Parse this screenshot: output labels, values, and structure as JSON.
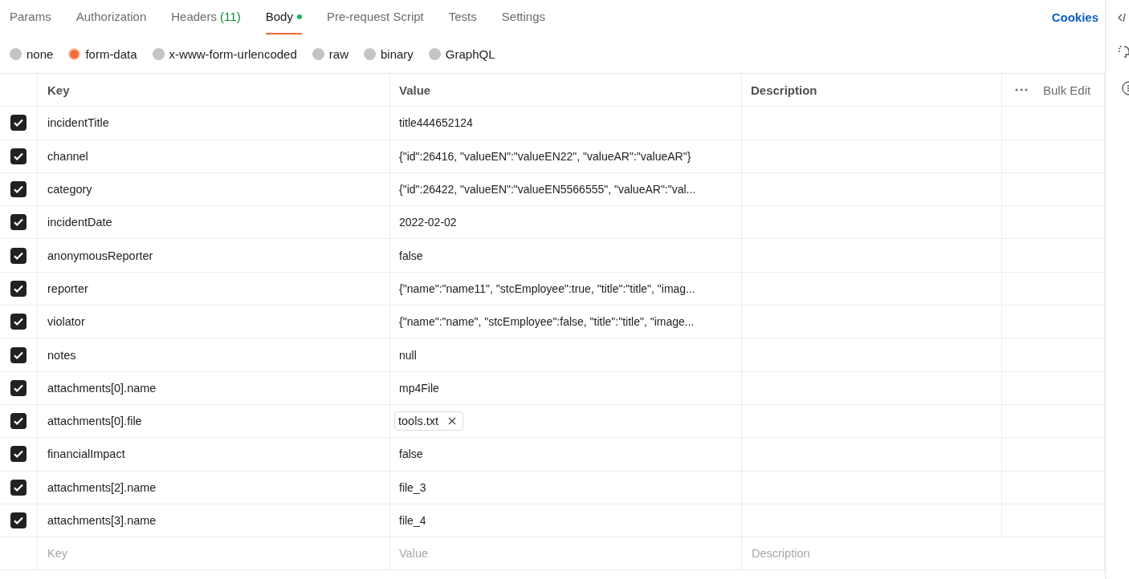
{
  "tabs": [
    {
      "label": "Params",
      "selected": false
    },
    {
      "label": "Authorization",
      "selected": false
    },
    {
      "label": "Headers",
      "count": "(11)",
      "selected": false
    },
    {
      "label": "Body",
      "dot": true,
      "selected": true
    },
    {
      "label": "Pre-request Script",
      "selected": false
    },
    {
      "label": "Tests",
      "selected": false
    },
    {
      "label": "Settings",
      "selected": false
    }
  ],
  "cookies_link": "Cookies",
  "body_types": [
    {
      "label": "none",
      "selected": false
    },
    {
      "label": "form-data",
      "selected": true
    },
    {
      "label": "x-www-form-urlencoded",
      "selected": false
    },
    {
      "label": "raw",
      "selected": false
    },
    {
      "label": "binary",
      "selected": false
    },
    {
      "label": "GraphQL",
      "selected": false
    }
  ],
  "table": {
    "columns": [
      "Key",
      "Value",
      "Description"
    ],
    "bulk_edit": "Bulk Edit",
    "rows": [
      {
        "checked": true,
        "key": "incidentTitle",
        "kind": "text",
        "value": "title444652124"
      },
      {
        "checked": true,
        "key": "channel",
        "kind": "text",
        "value": "{\"id\":26416, \"valueEN\":\"valueEN22\", \"valueAR\":\"valueAR\"}"
      },
      {
        "checked": true,
        "key": "category",
        "kind": "text",
        "value": "{\"id\":26422, \"valueEN\":\"valueEN5566555\", \"valueAR\":\"val..."
      },
      {
        "checked": true,
        "key": "incidentDate",
        "kind": "text",
        "value": "2022-02-02"
      },
      {
        "checked": true,
        "key": "anonymousReporter",
        "kind": "text",
        "value": "false"
      },
      {
        "checked": true,
        "key": "reporter",
        "kind": "text",
        "value": "{\"name\":\"name11\", \"stcEmployee\":true, \"title\":\"title\", \"imag..."
      },
      {
        "checked": true,
        "key": "violator",
        "kind": "text",
        "value": "{\"name\":\"name\", \"stcEmployee\":false, \"title\":\"title\", \"image..."
      },
      {
        "checked": true,
        "key": "notes",
        "kind": "text",
        "value": "null"
      },
      {
        "checked": true,
        "key": "attachments[0].name",
        "kind": "text",
        "value": "mp4File"
      },
      {
        "checked": true,
        "key": "attachments[0].file",
        "kind": "file",
        "value": "tools.txt"
      },
      {
        "checked": true,
        "key": "financialImpact",
        "kind": "text",
        "value": "false"
      },
      {
        "checked": true,
        "key": "attachments[2].name",
        "kind": "text",
        "value": "file_3"
      },
      {
        "checked": true,
        "key": "attachments[3].name",
        "kind": "text",
        "value": "file_4"
      }
    ],
    "new_row": {
      "key_placeholder": "Key",
      "value_placeholder": "Value",
      "description_placeholder": "Description"
    }
  }
}
